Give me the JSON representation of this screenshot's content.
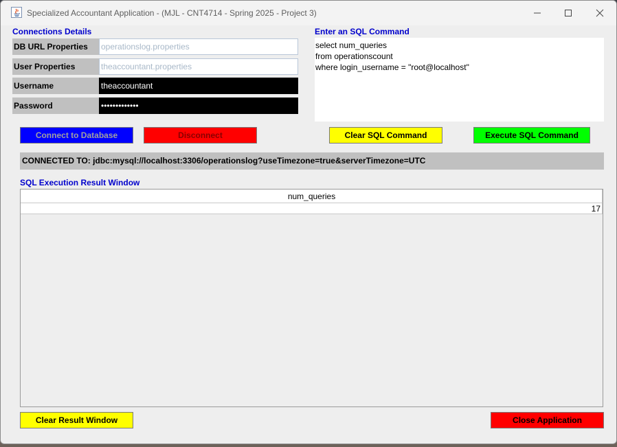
{
  "window": {
    "title": "Specialized Accountant Application - (MJL - CNT4714 - Spring 2025 - Project 3)"
  },
  "connection": {
    "section_title": "Connections Details",
    "fields": [
      {
        "label": "DB URL Properties",
        "value": "operationslog.properties"
      },
      {
        "label": "User Properties",
        "value": "theaccountant.properties"
      },
      {
        "label": "Username",
        "value": "theaccountant"
      },
      {
        "label": "Password",
        "value": "•••••••••••••"
      }
    ]
  },
  "sql": {
    "section_title": "Enter an SQL Command",
    "lines": [
      "select num_queries",
      "from operationscount",
      "where login_username = \"root@localhost\""
    ]
  },
  "buttons": {
    "connect": "Connect to Database",
    "disconnect": "Disconnect",
    "clear_sql": "Clear SQL Command",
    "execute_sql": "Execute SQL Command",
    "clear_result": "Clear Result Window",
    "close_app": "Close Application"
  },
  "status": {
    "text": "CONNECTED TO: jdbc:mysql://localhost:3306/operationslog?useTimezone=true&serverTimezone=UTC"
  },
  "results": {
    "section_title": "SQL Execution Result Window",
    "columns": [
      "num_queries"
    ],
    "rows": [
      [
        "17"
      ]
    ]
  },
  "colors": {
    "section_title": "#0000cc",
    "connect_bg": "#0000ff",
    "connect_fg": "#a0a0a0",
    "disconnect_bg": "#ff0000",
    "clear_bg": "#ffff00",
    "execute_bg": "#00ff00",
    "label_bg": "#c0c0c0"
  },
  "icons": [
    "java-app-icon",
    "minimize-icon",
    "maximize-icon",
    "close-icon"
  ]
}
